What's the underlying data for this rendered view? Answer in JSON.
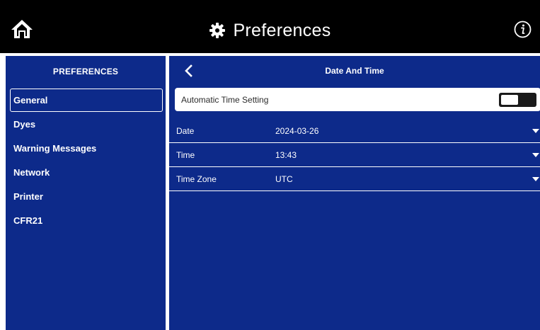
{
  "topbar": {
    "title": "Preferences",
    "home_icon": "home-icon",
    "gear_icon": "gear-icon",
    "info_icon": "info-icon"
  },
  "sidebar": {
    "header": "PREFERENCES",
    "items": [
      {
        "label": "General",
        "active": true
      },
      {
        "label": "Dyes",
        "active": false
      },
      {
        "label": "Warning Messages",
        "active": false
      },
      {
        "label": "Network",
        "active": false
      },
      {
        "label": "Printer",
        "active": false
      },
      {
        "label": "CFR21",
        "active": false
      }
    ]
  },
  "main": {
    "header": "Date And Time",
    "back_icon": "chevron-left-icon",
    "auto_time": {
      "label": "Automatic Time Setting",
      "enabled": false
    },
    "settings": [
      {
        "label": "Date",
        "value": "2024-03-26"
      },
      {
        "label": "Time",
        "value": "13:43"
      },
      {
        "label": "Time Zone",
        "value": "UTC"
      }
    ]
  },
  "colors": {
    "topbar_bg": "#000000",
    "panel_bg": "#0d2a8a",
    "text": "#ffffff",
    "toggle_off": "#1a1a1a"
  }
}
